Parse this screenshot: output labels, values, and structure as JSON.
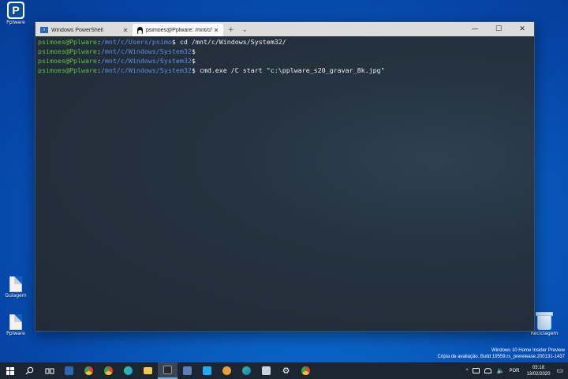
{
  "desktop": {
    "icons": [
      {
        "label": "Pplware"
      },
      {
        "label": "Guiagem"
      },
      {
        "label": "Pplware"
      },
      {
        "label": "Reciclagem"
      }
    ]
  },
  "terminal": {
    "tabs": [
      {
        "label": "Windows PowerShell",
        "icon": "powershell-icon"
      },
      {
        "label": "psimoes@Pplware: /mnt/c/Wi",
        "icon": "linux-icon"
      }
    ],
    "new_tab": "+",
    "dropdown": "⌄",
    "controls": {
      "minimize": "—",
      "maximize": "☐",
      "close": "✕"
    },
    "lines": [
      {
        "user": "psimoes@Pplware",
        "sep": ":",
        "path": "/mnt/c/Users/psimo",
        "prompt": "$",
        "command": " cd /mnt/c/Windows/System32/"
      },
      {
        "user": "psimoes@Pplware",
        "sep": ":",
        "path": "/mnt/c/Windows/System32",
        "prompt": "$",
        "command": ""
      },
      {
        "user": "psimoes@Pplware",
        "sep": ":",
        "path": "/mnt/c/Windows/System32",
        "prompt": "$",
        "command": ""
      },
      {
        "user": "psimoes@Pplware",
        "sep": ":",
        "path": "/mnt/c/Windows/System32",
        "prompt": "$",
        "command": " cmd.exe /C start \"c:\\pplware_s20_gravar_8k.jpg\""
      }
    ]
  },
  "watermark": {
    "line1": "Windows 10 Home Insider Preview",
    "line2": "Cópia de avaliação. Build 19559.rs_prerelease.200131-1437"
  },
  "taskbar": {
    "apps": [
      {
        "name": "start-button",
        "color": "#ffffff"
      },
      {
        "name": "search-button",
        "color": "#ffffff"
      },
      {
        "name": "task-view-button",
        "color": "#ffffff"
      },
      {
        "name": "app-blue-button",
        "color": "#2b67b3"
      },
      {
        "name": "chrome-button",
        "color": "#e34133"
      },
      {
        "name": "chrome-alt-button",
        "color": "#e34133"
      },
      {
        "name": "edge-button",
        "color": "#1fa0e0"
      },
      {
        "name": "explorer-button",
        "color": "#f2c94c"
      },
      {
        "name": "terminal-button",
        "color": "#4a4a4a"
      },
      {
        "name": "calculator-button",
        "color": "#5b7fb7"
      },
      {
        "name": "vscode-button",
        "color": "#23a9f2"
      },
      {
        "name": "paint-button",
        "color": "#e9a03b"
      },
      {
        "name": "edge-beta-button",
        "color": "#31c48d"
      },
      {
        "name": "device-button",
        "color": "#c9d3df"
      },
      {
        "name": "settings-button",
        "color": "#ffffff"
      },
      {
        "name": "chrome-canary-button",
        "color": "#e34133"
      }
    ],
    "tray": {
      "lang": "POR",
      "time": "03:18",
      "date": "13/02/2020"
    }
  }
}
